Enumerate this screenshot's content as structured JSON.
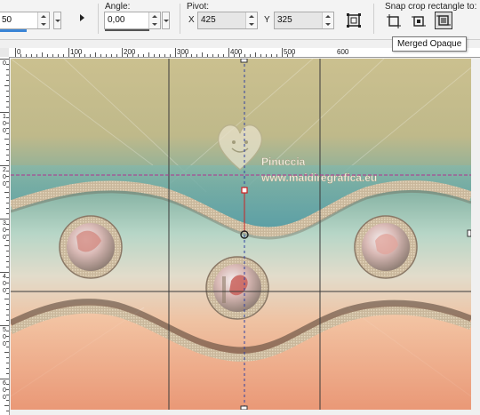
{
  "toolbar": {
    "size_value": "50",
    "angle": {
      "label": "Angle:",
      "value": "0,00"
    },
    "pivot": {
      "label": "Pivot:",
      "x_label": "X",
      "x_value": "425",
      "y_label": "Y",
      "y_value": "325"
    },
    "snap": {
      "label": "Snap crop rectangle to:"
    }
  },
  "tooltip": "Merged Opaque",
  "ruler": {
    "h_labels": [
      "0",
      "100",
      "200",
      "300",
      "400",
      "500",
      "600"
    ],
    "v_labels": [
      "0",
      "100",
      "200",
      "300",
      "400",
      "500",
      "600"
    ]
  },
  "canvas": {
    "watermark_line1": "Pinuccia",
    "watermark_line2": "www.maidiregrafica.eu"
  }
}
